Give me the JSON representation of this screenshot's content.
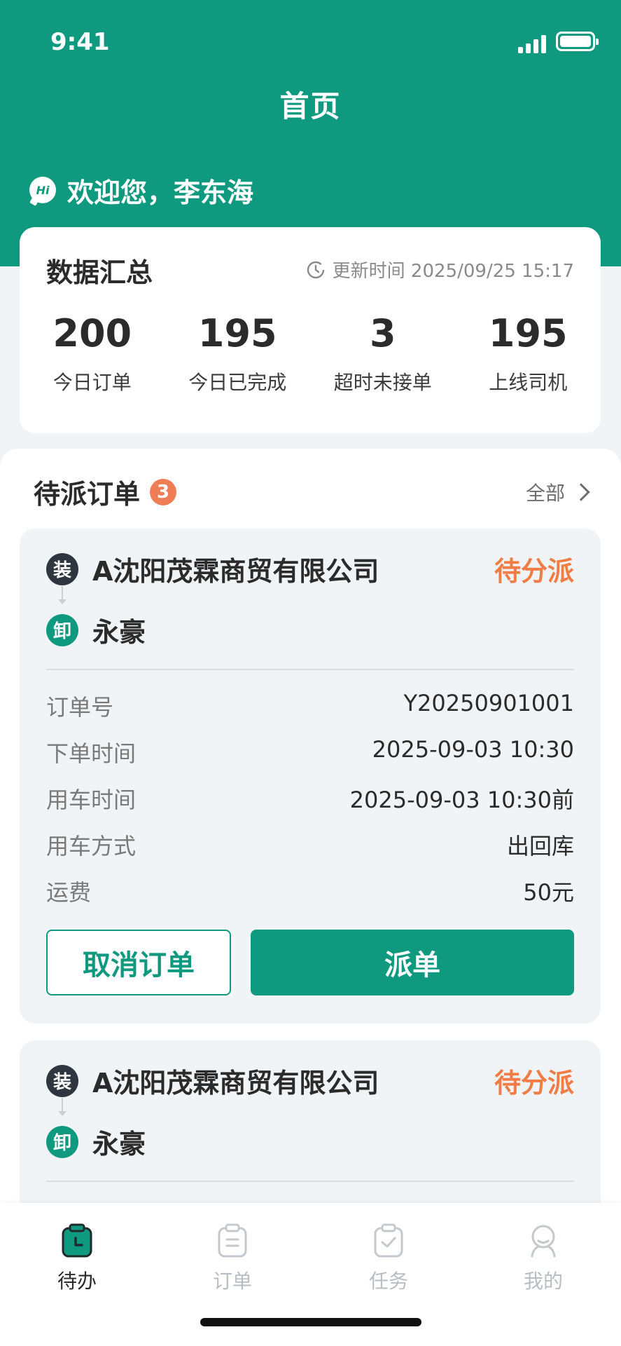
{
  "status_bar": {
    "time": "9:41"
  },
  "header": {
    "title": "首页",
    "welcome": "欢迎您，李东海",
    "hi_icon": "Hi"
  },
  "summary": {
    "title": "数据汇总",
    "update_label": "更新时间 2025/09/25 15:17",
    "stats": [
      {
        "value": "200",
        "label": "今日订单"
      },
      {
        "value": "195",
        "label": "今日已完成"
      },
      {
        "value": "3",
        "label": "超时未接单"
      },
      {
        "value": "195",
        "label": "上线司机"
      }
    ]
  },
  "pending": {
    "title": "待派订单",
    "count": "3",
    "all_label": "全部",
    "orders": [
      {
        "load_mark": "装",
        "load_text": "A沈阳茂霖商贸有限公司",
        "unload_mark": "卸",
        "unload_text": "永豪",
        "status": "待分派",
        "fields": [
          {
            "label": "订单号",
            "value": "Y20250901001"
          },
          {
            "label": "下单时间",
            "value": "2025-09-03 10:30"
          },
          {
            "label": "用车时间",
            "value": "2025-09-03 10:30前"
          },
          {
            "label": "用车方式",
            "value": "出回库"
          },
          {
            "label": "运费",
            "value": "50元"
          }
        ],
        "cancel_label": "取消订单",
        "dispatch_label": "派单"
      },
      {
        "load_mark": "装",
        "load_text": "A沈阳茂霖商贸有限公司",
        "unload_mark": "卸",
        "unload_text": "永豪",
        "status": "待分派"
      }
    ]
  },
  "tabbar": {
    "tabs": [
      {
        "label": "待办",
        "icon": "todo-clipboard-clock-icon",
        "active": true
      },
      {
        "label": "订单",
        "icon": "order-clipboard-icon"
      },
      {
        "label": "任务",
        "icon": "task-clipboard-check-icon"
      },
      {
        "label": "我的",
        "icon": "profile-user-icon"
      }
    ]
  },
  "colors": {
    "brand": "#0f9a80",
    "status_pending": "#f07d45",
    "badge": "#ef7d55"
  }
}
